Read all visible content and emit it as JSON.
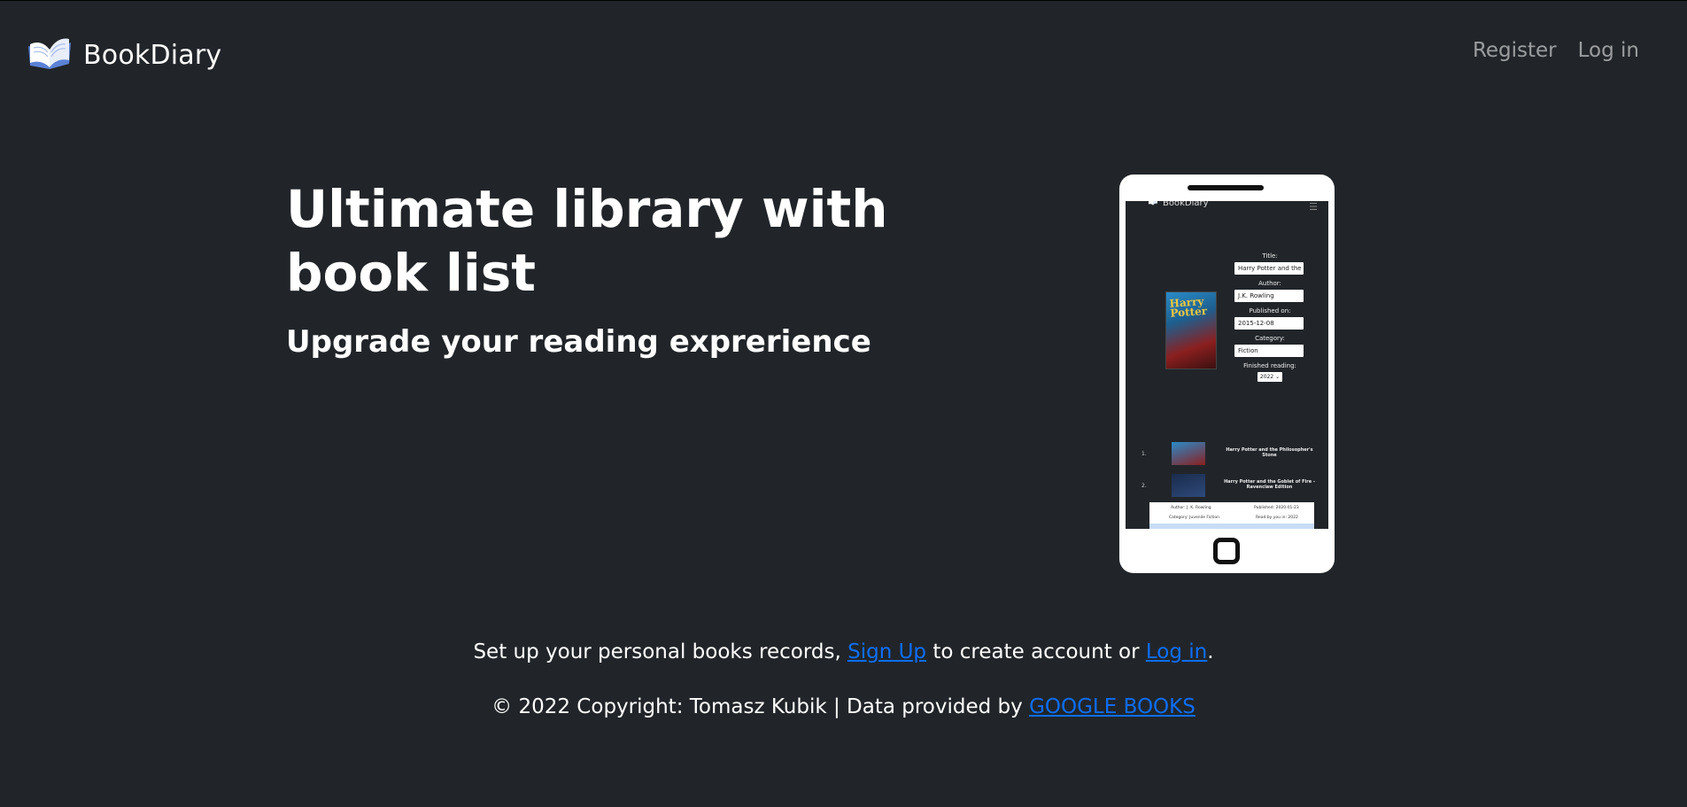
{
  "navbar": {
    "brand": "BookDiary",
    "links": [
      {
        "label": "Register"
      },
      {
        "label": "Log in"
      }
    ]
  },
  "hero": {
    "title": "Ultimate library with book list",
    "subtitle": "Upgrade your reading exprerience"
  },
  "mockup": {
    "brand": "BookDiary",
    "cover_text": "Harry Potter",
    "form": {
      "title_label": "Title:",
      "title_value": "Harry Potter and the Philosopher's Stone",
      "author_label": "Author:",
      "author_value": "J.K. Rowling",
      "published_label": "Published on:",
      "published_value": "2015-12-08",
      "category_label": "Category:",
      "category_value": "Fiction",
      "finished_label": "Finished reading:",
      "finished_value": "2022"
    },
    "list": [
      {
        "num": "1.",
        "title": "Harry Potter and the Philosopher's Stone"
      },
      {
        "num": "2.",
        "title": "Harry Potter and the Goblet of Fire - Ravenclaw Edition"
      }
    ],
    "details": {
      "author": "Author: J. K. Rowling",
      "published": "Published: 2020-01-23",
      "category": "Category: Juvenile Fiction",
      "read": "Read by you in: 2022"
    }
  },
  "cta": {
    "before": "Set up your personal books records, ",
    "signup": "Sign Up",
    "middle": " to create account or ",
    "login": "Log in",
    "after": "."
  },
  "footer": {
    "text": "© 2022 Copyright: Tomasz Kubik | Data provided by ",
    "link": "GOOGLE BOOKS"
  },
  "colors": {
    "background": "#212529",
    "link": "#0d6efd",
    "nav_link": "#8c8f92"
  }
}
